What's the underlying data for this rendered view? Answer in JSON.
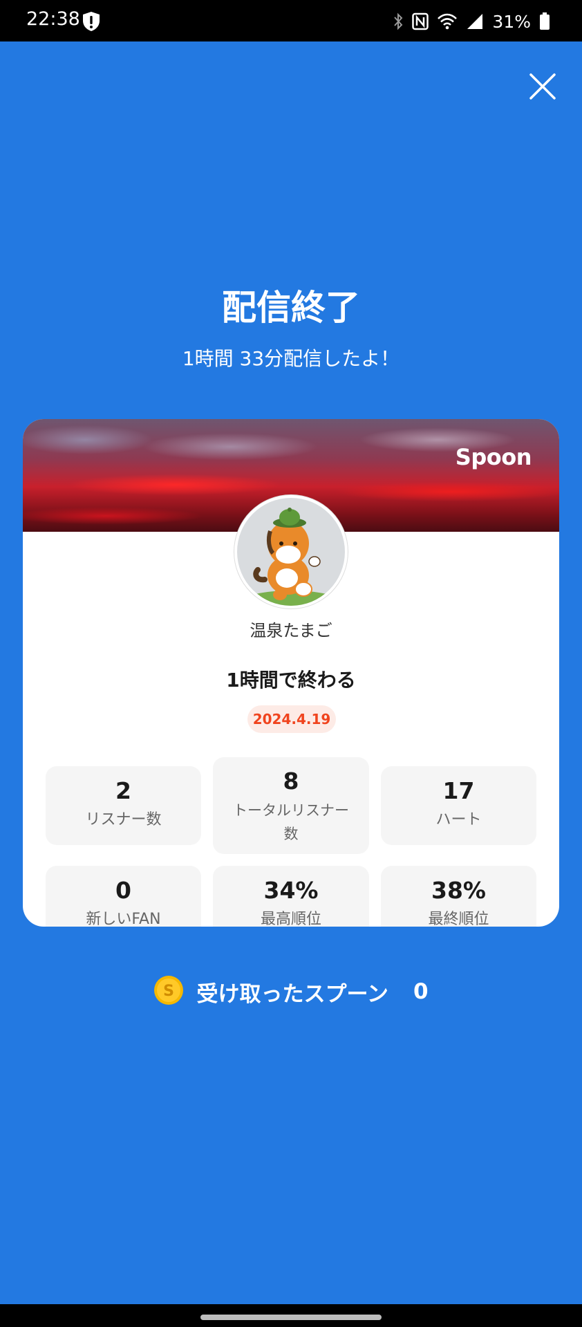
{
  "status_bar": {
    "time": "22:38",
    "battery": "31%",
    "icons": [
      "shield-alert-icon",
      "bluetooth-icon",
      "nfc-icon",
      "wifi-icon",
      "signal-icon",
      "battery-icon"
    ]
  },
  "header": {
    "title": "配信終了",
    "subtitle": "1時間 33分配信したよ！"
  },
  "card": {
    "brand": "Spoon",
    "username": "温泉たまご",
    "stream_title": "1時間で終わる",
    "date": "2024.4.19",
    "stats": [
      {
        "value": "2",
        "label": "リスナー数"
      },
      {
        "value": "8",
        "label_line1": "トータルリスナー",
        "label_line2": "数"
      },
      {
        "value": "17",
        "label": "ハート"
      },
      {
        "value": "0",
        "label": "新しいFAN"
      },
      {
        "value": "34%",
        "label": "最高順位"
      },
      {
        "value": "38%",
        "label": "最終順位"
      }
    ]
  },
  "spoons": {
    "label": "受け取ったスプーン",
    "count": "0",
    "icon": "spoon-coin-icon"
  },
  "colors": {
    "background": "#2379e1",
    "date_accent": "#f0441e",
    "coin": "#f5b800"
  }
}
